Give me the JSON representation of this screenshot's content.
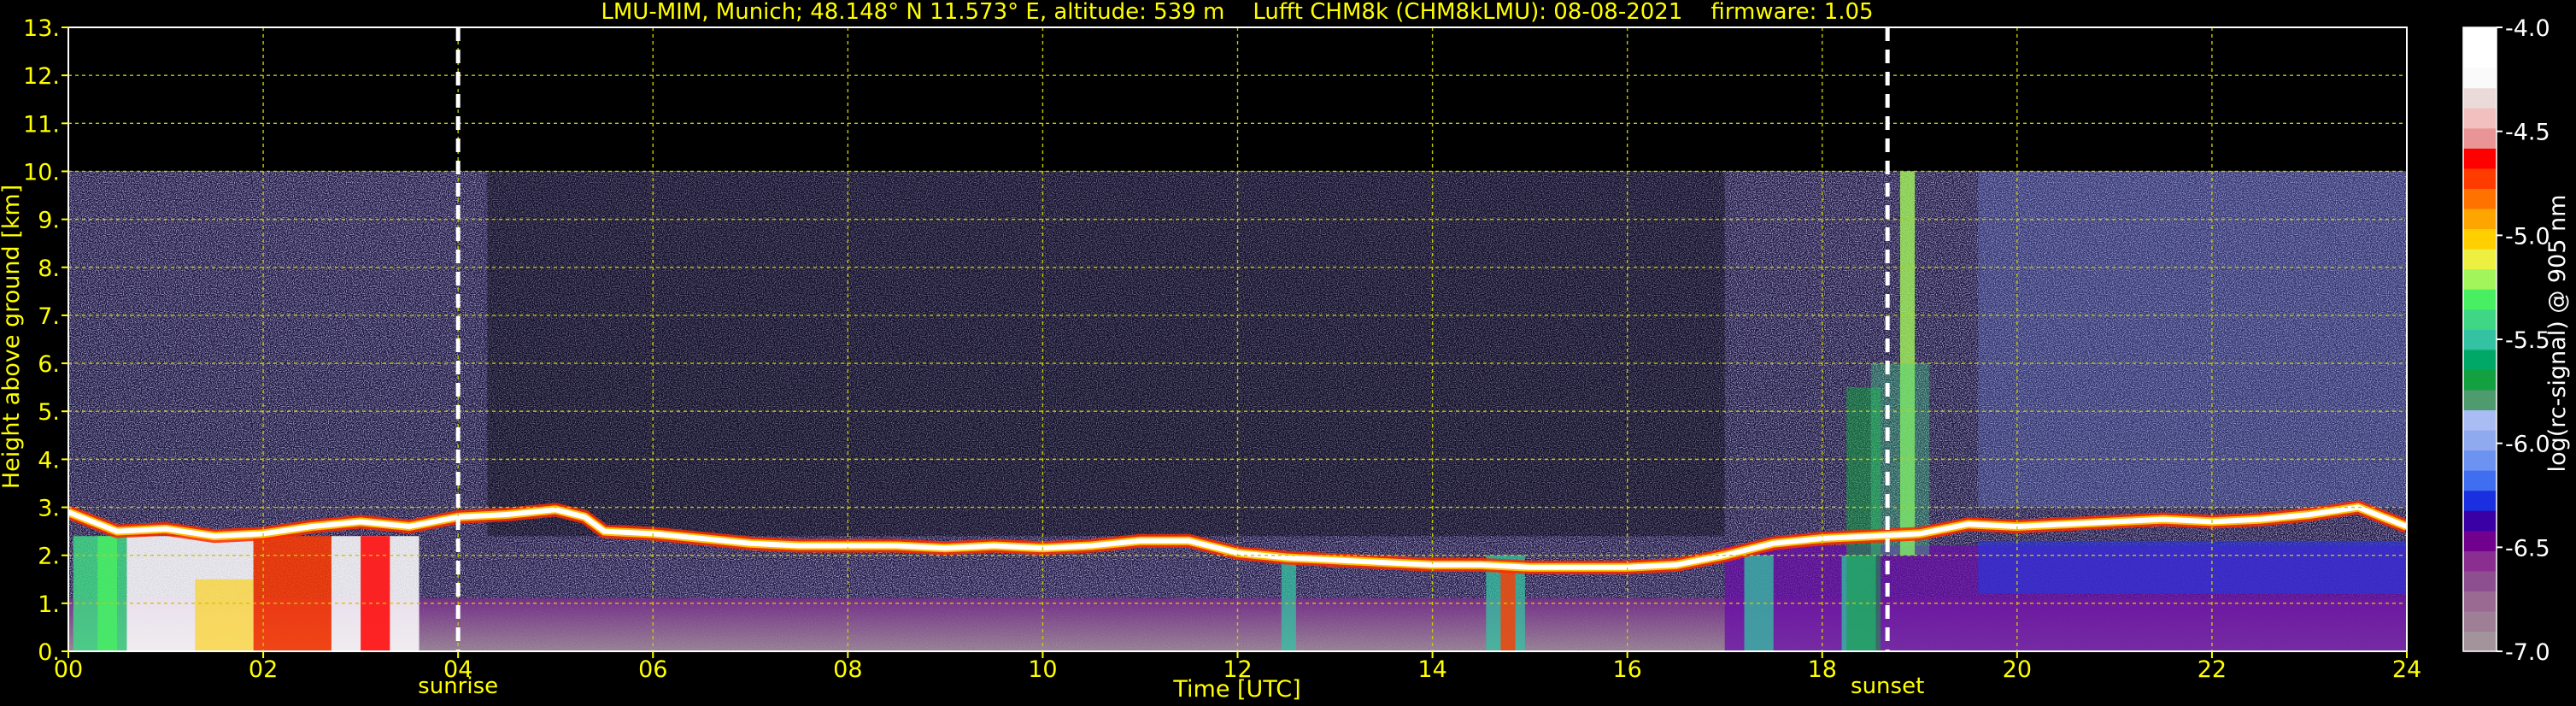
{
  "header": {
    "title": "LMU-MIM, Munich; 48.148° N 11.573° E, altitude: 539 m    Lufft CHM8k (CHM8kLMU): 08-08-2021    firmware: 1.05"
  },
  "colors": {
    "axis_text": "#ffff00",
    "grid": "#c8c800",
    "background": "#000000",
    "marker_line": "#ffffff",
    "colorbar_label": "#ffffff"
  },
  "chart_data": {
    "type": "heatmap",
    "title": "LMU-MIM, Munich; 48.148° N 11.573° E, altitude: 539 m    Lufft CHM8k (CHM8kLMU): 08-08-2021    firmware: 1.05",
    "xlabel": "Time [UTC]",
    "ylabel": "Height above ground [km]",
    "xlim": [
      0,
      24
    ],
    "ylim": [
      0,
      13
    ],
    "x_ticks": [
      0,
      2,
      4,
      6,
      8,
      10,
      12,
      14,
      16,
      18,
      20,
      22,
      24
    ],
    "x_tick_labels": [
      "00",
      "02",
      "04",
      "06",
      "08",
      "10",
      "12",
      "14",
      "16",
      "18",
      "20",
      "22",
      "24"
    ],
    "y_ticks": [
      0,
      1,
      2,
      3,
      4,
      5,
      6,
      7,
      8,
      9,
      10,
      11,
      12,
      13
    ],
    "y_tick_labels": [
      "0.",
      "1.",
      "2.",
      "3.",
      "4.",
      "5.",
      "6.",
      "7.",
      "8.",
      "9.",
      "10.",
      "11.",
      "12.",
      "13."
    ],
    "grid": true,
    "data_max_height_km": 10,
    "markers": [
      {
        "label": "sunrise",
        "x": 4.0
      },
      {
        "label": "sunset",
        "x": 18.67
      }
    ],
    "colorbar": {
      "label": "log(rc-signal) @ 905 nm",
      "range": [
        -7.0,
        -4.0
      ],
      "ticks": [
        -4.0,
        -4.5,
        -5.0,
        -5.5,
        -6.0,
        -6.5,
        -7.0
      ],
      "tick_labels": [
        "-4.0",
        "-4.5",
        "-5.0",
        "-5.5",
        "-6.0",
        "-6.5",
        "-7.0"
      ],
      "colors": [
        "#a3949c",
        "#9e7f95",
        "#9a6a92",
        "#8d4f90",
        "#8a2e92",
        "#71008e",
        "#3a00a6",
        "#1a30e0",
        "#3f6ef0",
        "#6c92f2",
        "#90aaf0",
        "#a9bcf4",
        "#4e9c6e",
        "#12a040",
        "#00a867",
        "#33c3a2",
        "#3fd785",
        "#49ef62",
        "#a2f55b",
        "#eef041",
        "#ffcf00",
        "#ffa500",
        "#ff7200",
        "#ff3b00",
        "#ff0000",
        "#ea9595",
        "#f3c0c0",
        "#eadada",
        "#fafafa",
        "#ffffff",
        "#ffffff"
      ]
    },
    "features": {
      "cloud_base_km": [
        {
          "x": 0.0,
          "y": 2.9
        },
        {
          "x": 0.5,
          "y": 2.5
        },
        {
          "x": 1.0,
          "y": 2.55
        },
        {
          "x": 1.5,
          "y": 2.4
        },
        {
          "x": 2.0,
          "y": 2.45
        },
        {
          "x": 2.5,
          "y": 2.6
        },
        {
          "x": 3.0,
          "y": 2.7
        },
        {
          "x": 3.5,
          "y": 2.6
        },
        {
          "x": 4.0,
          "y": 2.8
        },
        {
          "x": 4.5,
          "y": 2.85
        },
        {
          "x": 5.0,
          "y": 2.95
        },
        {
          "x": 5.3,
          "y": 2.8
        },
        {
          "x": 5.5,
          "y": 2.5
        },
        {
          "x": 6.0,
          "y": 2.45
        },
        {
          "x": 6.5,
          "y": 2.35
        },
        {
          "x": 7.0,
          "y": 2.25
        },
        {
          "x": 7.5,
          "y": 2.2
        },
        {
          "x": 8.0,
          "y": 2.2
        },
        {
          "x": 8.5,
          "y": 2.2
        },
        {
          "x": 9.0,
          "y": 2.15
        },
        {
          "x": 9.5,
          "y": 2.2
        },
        {
          "x": 10.0,
          "y": 2.15
        },
        {
          "x": 10.5,
          "y": 2.2
        },
        {
          "x": 11.0,
          "y": 2.3
        },
        {
          "x": 11.5,
          "y": 2.3
        },
        {
          "x": 12.0,
          "y": 2.05
        },
        {
          "x": 12.5,
          "y": 1.95
        },
        {
          "x": 13.0,
          "y": 1.9
        },
        {
          "x": 13.5,
          "y": 1.85
        },
        {
          "x": 14.0,
          "y": 1.8
        },
        {
          "x": 14.5,
          "y": 1.8
        },
        {
          "x": 15.0,
          "y": 1.75
        },
        {
          "x": 15.5,
          "y": 1.75
        },
        {
          "x": 16.0,
          "y": 1.75
        },
        {
          "x": 16.5,
          "y": 1.8
        },
        {
          "x": 17.0,
          "y": 2.0
        },
        {
          "x": 17.5,
          "y": 2.25
        },
        {
          "x": 18.0,
          "y": 2.35
        },
        {
          "x": 18.5,
          "y": 2.4
        },
        {
          "x": 19.0,
          "y": 2.45
        },
        {
          "x": 19.5,
          "y": 2.65
        },
        {
          "x": 20.0,
          "y": 2.6
        },
        {
          "x": 20.5,
          "y": 2.65
        },
        {
          "x": 21.0,
          "y": 2.7
        },
        {
          "x": 21.5,
          "y": 2.75
        },
        {
          "x": 22.0,
          "y": 2.7
        },
        {
          "x": 22.5,
          "y": 2.75
        },
        {
          "x": 23.0,
          "y": 2.85
        },
        {
          "x": 23.5,
          "y": 3.0
        },
        {
          "x": 24.0,
          "y": 2.6
        }
      ]
    }
  }
}
